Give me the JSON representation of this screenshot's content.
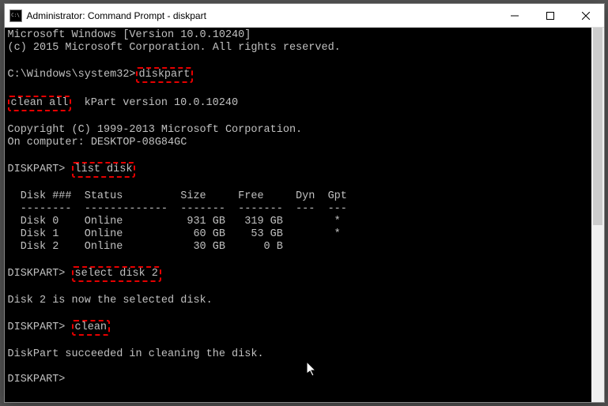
{
  "window": {
    "title": "Administrator: Command Prompt - diskpart"
  },
  "os": {
    "banner_line1": "Microsoft Windows [Version 10.0.10240]",
    "banner_line2": "(c) 2015 Microsoft Corporation. All rights reserved."
  },
  "prompt1": {
    "path": "C:\\Windows\\system32>",
    "cmd": "diskpart"
  },
  "highlight_clean_all": "clean all",
  "dp_version_suffix": "kPart version 10.0.10240",
  "dp_copyright": "Copyright (C) 1999-2013 Microsoft Corporation.",
  "dp_computer": "On computer: DESKTOP-08G84GC",
  "dp_prompt": "DISKPART>",
  "cmd_list": "list disk",
  "table": {
    "header": "  Disk ###  Status         Size     Free     Dyn  Gpt",
    "divider": "  --------  -------------  -------  -------  ---  ---",
    "rows": [
      "  Disk 0    Online          931 GB   319 GB        *",
      "  Disk 1    Online           60 GB    53 GB        *",
      "  Disk 2    Online           30 GB      0 B"
    ]
  },
  "cmd_select": "select disk 2",
  "msg_selected": "Disk 2 is now the selected disk.",
  "cmd_clean": "clean",
  "msg_clean_ok": "DiskPart succeeded in cleaning the disk."
}
